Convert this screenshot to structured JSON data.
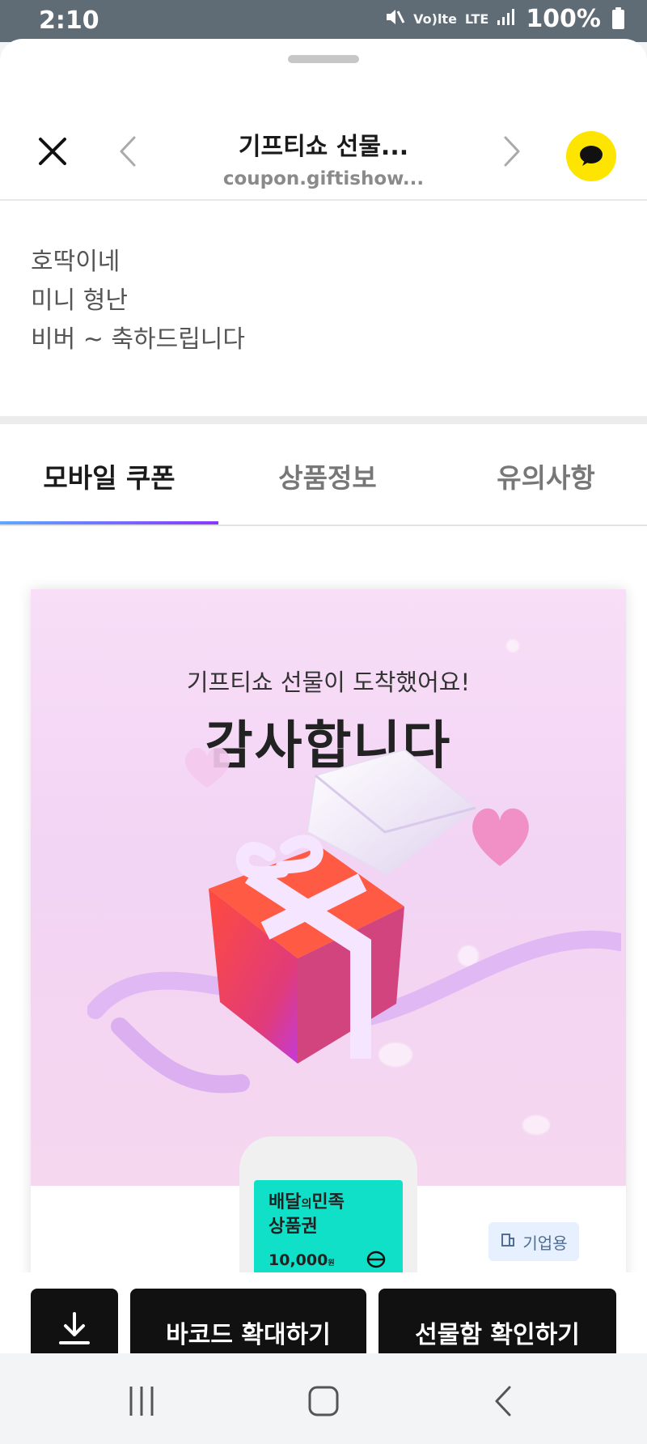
{
  "status": {
    "time": "2:10",
    "volte": "Vo)lte",
    "lte": "LTE",
    "battery": "100%"
  },
  "toolbar": {
    "title": "기프티쇼 선물...",
    "url": "coupon.giftishow..."
  },
  "message": {
    "lines": [
      "호딱이네",
      "미니 형난",
      "비버 ~ 축하드립니다"
    ]
  },
  "tabs": [
    {
      "label": "모바일 쿠폰"
    },
    {
      "label": "상품정보"
    },
    {
      "label": "유의사항"
    }
  ],
  "coupon": {
    "hero_subtitle": "기프티쇼 선물이 도착했어요!",
    "hero_title": "감사합니다",
    "voucher": {
      "brand_line1": "배달",
      "brand_small": "의",
      "brand_line1b": "민족",
      "brand_line2": "상품권",
      "amount": "10,000",
      "currency": "원"
    },
    "badge_label": "기업용"
  },
  "actions": {
    "barcode_label": "바코드 확대하기",
    "giftbox_label": "선물함 확인하기"
  },
  "icons": {
    "close": "close-icon",
    "back": "chevron-left-icon",
    "forward": "chevron-right-icon",
    "kakao": "kakao-chat-icon",
    "download": "download-icon",
    "recent_apps": "recent-apps-icon",
    "home": "home-icon",
    "system_back": "back-icon"
  },
  "colors": {
    "accent_start": "#5ea8ff",
    "accent_end": "#8a36ff",
    "kakao_yellow": "#fde500",
    "voucher_mint": "#10e0c8"
  }
}
